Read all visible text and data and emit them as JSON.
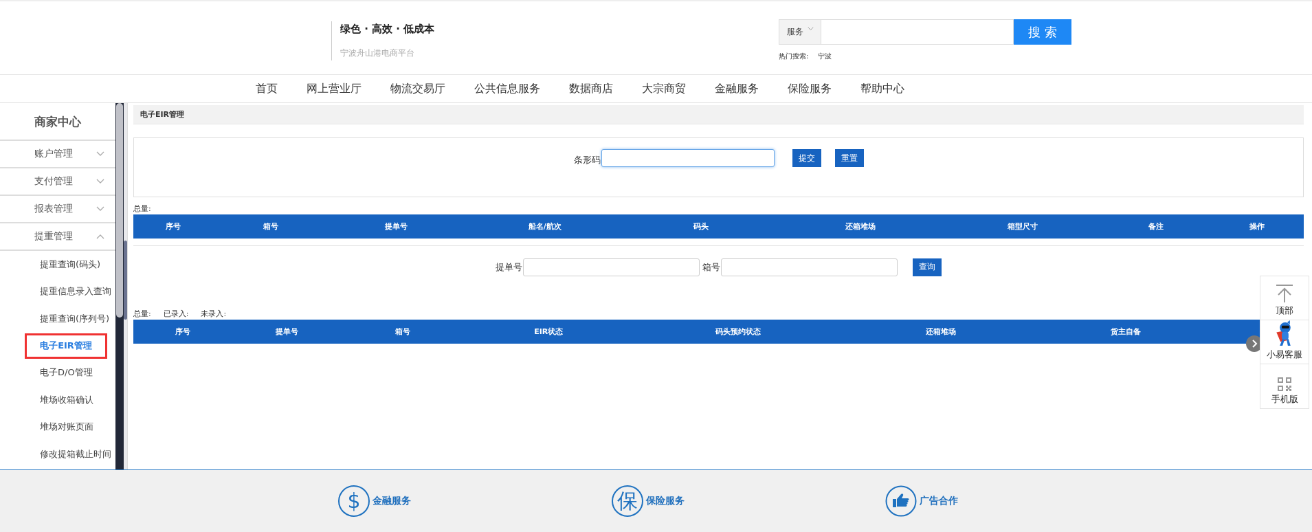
{
  "header": {
    "slogan": "绿色 · 高效 · 低成本",
    "subtitle": "宁波舟山港电商平台",
    "search": {
      "category": "服务",
      "button": "搜 索",
      "hot_label": "热门搜索:",
      "hot_terms": [
        "宁波"
      ]
    }
  },
  "nav": [
    "首页",
    "网上营业厅",
    "物流交易厅",
    "公共信息服务",
    "数据商店",
    "大宗商贸",
    "金融服务",
    "保险服务",
    "帮助中心"
  ],
  "sidebar": {
    "title": "商家中心",
    "items": [
      {
        "label": "账户管理",
        "expanded": false
      },
      {
        "label": "支付管理",
        "expanded": false
      },
      {
        "label": "报表管理",
        "expanded": false
      },
      {
        "label": "提重管理",
        "expanded": true,
        "children": [
          {
            "label": "提重查询(码头)",
            "selected": false
          },
          {
            "label": "提重信息录入查询",
            "selected": false
          },
          {
            "label": "提重查询(序列号)",
            "selected": false
          },
          {
            "label": "电子EIR管理",
            "selected": true
          },
          {
            "label": "电子D/O管理",
            "selected": false
          },
          {
            "label": "堆场收箱确认",
            "selected": false
          },
          {
            "label": "堆场对账页面",
            "selected": false
          },
          {
            "label": "修改提箱截止时间",
            "selected": false
          }
        ]
      }
    ]
  },
  "panel": {
    "title": "电子EIR管理",
    "barcode_form": {
      "label": "条形码",
      "focused": true,
      "buttons": [
        "提交",
        "重置"
      ]
    },
    "table1": {
      "counts": [
        "总量:"
      ],
      "columns": [
        "序号",
        "箱号",
        "提单号",
        "船名/航次",
        "码头",
        "还箱堆场",
        "箱型尺寸",
        "备注",
        "操作"
      ]
    },
    "query_form": {
      "fields": [
        "提单号",
        "箱号"
      ],
      "button": "查询"
    },
    "table2": {
      "counts": [
        "总量:",
        "已录入:",
        "未录入:"
      ],
      "columns": [
        "序号",
        "提单号",
        "箱号",
        "EIR状态",
        "码头预约状态",
        "还箱堆场",
        "货主自备"
      ]
    }
  },
  "float_bar": [
    {
      "kind": "top",
      "label": "顶部"
    },
    {
      "kind": "service",
      "label": "小易客服"
    },
    {
      "kind": "qr",
      "label": "手机版"
    }
  ],
  "footer": [
    {
      "kind": "char",
      "icon": "$",
      "label": "金融服务"
    },
    {
      "kind": "char",
      "icon": "保",
      "label": "保险服务"
    },
    {
      "kind": "hand",
      "label": "广告合作"
    }
  ]
}
